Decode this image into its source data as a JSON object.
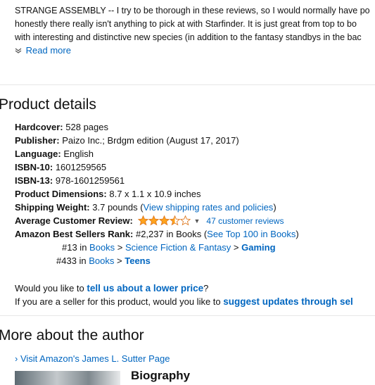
{
  "review": {
    "line1": "STRANGE ASSEMBLY -- I try to be thorough in these reviews, so I would normally have po",
    "line2": "honestly there really isn't anything to pick at with Starfinder. It is just great from top to bo",
    "line3": "with interesting and distinctive new species (in addition to the fantasy standbys in the bac",
    "read_more": "Read more"
  },
  "product_details": {
    "title": "Product details",
    "hardcover_label": "Hardcover:",
    "hardcover_value": "528 pages",
    "publisher_label": "Publisher:",
    "publisher_value": "Paizo Inc.; Brdgm edition (August 17, 2017)",
    "language_label": "Language:",
    "language_value": "English",
    "isbn10_label": "ISBN-10:",
    "isbn10_value": "1601259565",
    "isbn13_label": "ISBN-13:",
    "isbn13_value": "978-1601259561",
    "dimensions_label": "Product Dimensions:",
    "dimensions_value": "8.7 x 1.1 x 10.9 inches",
    "weight_label": "Shipping Weight:",
    "weight_value": "3.7 pounds (",
    "weight_link": "View shipping rates and policies",
    "weight_close": ")",
    "review_label": "Average Customer Review:",
    "rating": 3.5,
    "star_color": "#ffa41c",
    "review_count": "47 customer reviews",
    "rank_label": "Amazon Best Sellers Rank:",
    "rank_value": "#2,237 in Books (",
    "rank_link": "See Top 100 in Books",
    "rank_close": ")",
    "sub1_rank": "#13 in ",
    "sub1_cat1": "Books",
    "sub_sep": " > ",
    "sub1_cat2": "Science Fiction & Fantasy",
    "sub1_cat3": "Gaming",
    "sub2_rank": "#433 in ",
    "sub2_cat1": "Books",
    "sub2_cat2": "Teens"
  },
  "feedback": {
    "line1_pre": "Would you like to ",
    "line1_link": "tell us about a lower price",
    "line1_post": "?",
    "line2_pre": "If you are a seller for this product, would you like to ",
    "line2_link": "suggest updates through sel"
  },
  "author": {
    "title": "More about the author",
    "visit_link": "› Visit Amazon's James L. Sutter Page",
    "bio_title": "Biography"
  }
}
